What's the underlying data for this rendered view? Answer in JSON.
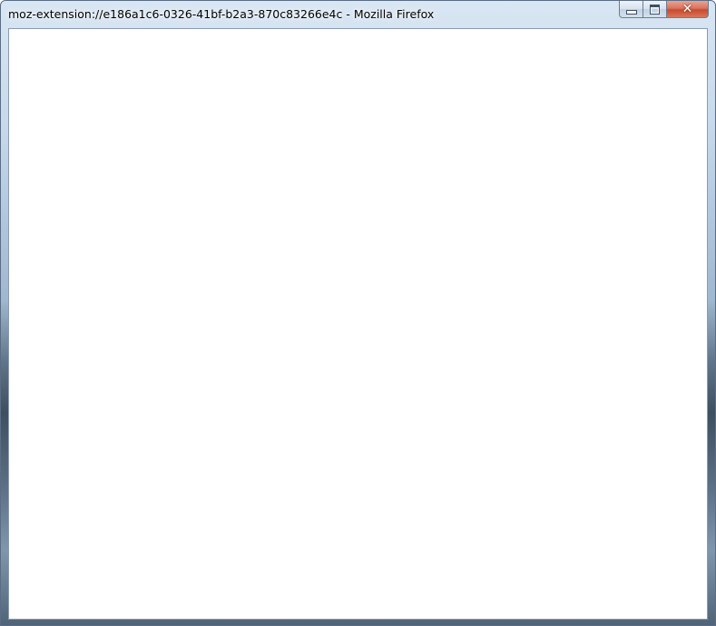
{
  "window": {
    "title": "moz-extension://e186a1c6-0326-41bf-b2a3-870c83266e4c - Mozilla Firefox",
    "controls": {
      "minimize_icon": "minimize-icon",
      "maximize_icon": "maximize-icon",
      "close_icon": "close-icon",
      "close_glyph": "✕"
    },
    "close_color": "#c84a2f"
  },
  "content": {
    "background": "#ffffff"
  }
}
